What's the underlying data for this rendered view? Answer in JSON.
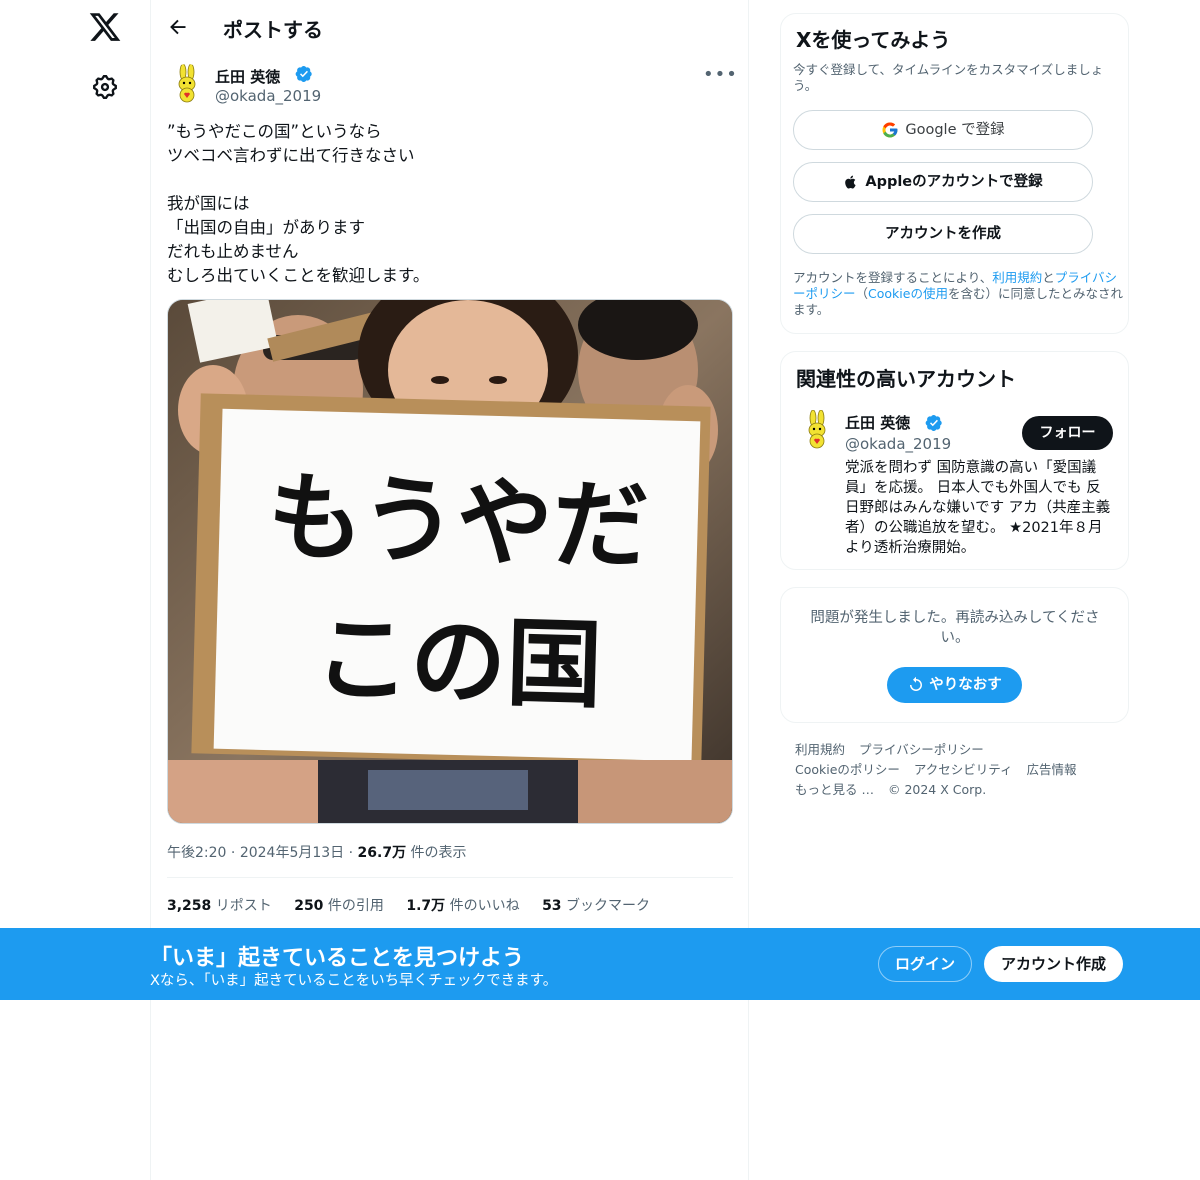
{
  "nav": {
    "logo_icon": "x-logo-icon",
    "settings_icon": "gear-icon"
  },
  "header": {
    "title": "ポストする",
    "back_icon": "arrow-left-icon"
  },
  "post": {
    "author_name": "丘田 英徳",
    "author_handle": "@okada_2019",
    "verified": true,
    "text": "”もうやだこの国”というなら\nツベコベ言わずに出て行きなさい\n\n我が国には\n「出国の自由」があります\nだれも止めません\nむしろ出ていくことを歓迎します。",
    "image_sign_line1": "もうやだ",
    "image_sign_line2": "この国",
    "time": "午後2:20",
    "date": "2024年5月13日",
    "views_count": "26.7万",
    "views_label": "件の表示",
    "stats": {
      "reposts_count": "3,258",
      "reposts_label": "リポスト",
      "quotes_count": "250",
      "quotes_label": "件の引用",
      "likes_count": "1.7万",
      "likes_label": "件のいいね",
      "bookmarks_count": "53",
      "bookmarks_label": "ブックマーク"
    }
  },
  "signup_card": {
    "title": "Xを使ってみよう",
    "subtitle": "今すぐ登録して、タイムラインをカスタマイズしましょう。",
    "google_label": "Google で登録",
    "apple_label": "Appleのアカウントで登録",
    "create_label": "アカウントを作成",
    "terms_prefix": "アカウントを登録することにより、",
    "terms_link": "利用規約",
    "terms_and": "と",
    "privacy_link": "プライバシーポリシー",
    "terms_paren_open": "（",
    "cookie_link": "Cookieの使用",
    "terms_suffix": "を含む）に同意したとみなされます。"
  },
  "related": {
    "title": "関連性の高いアカウント",
    "name": "丘田 英徳",
    "handle": "@okada_2019",
    "follow_label": "フォロー",
    "bio": "党派を問わず 国防意識の高い「愛国議員」を応援。 日本人でも外国人でも 反日野郎はみんな嫌いです アカ（共産主義者）の公職追放を望む。 ★2021年８月より透析治療開始。"
  },
  "error_card": {
    "message": "問題が発生しました。再読み込みしてください。",
    "retry_label": "やりなおす"
  },
  "footer": {
    "links": [
      "利用規約",
      "プライバシーポリシー",
      "Cookieのポリシー",
      "アクセシビリティ",
      "広告情報",
      "もっと見る …"
    ],
    "copyright": "© 2024 X Corp."
  },
  "banner": {
    "title": "「いま」起きていることを見つけよう",
    "subtitle": "Xなら、「いま」起きていることをいち早くチェックできます。",
    "login_label": "ログイン",
    "signup_label": "アカウント作成"
  },
  "colors": {
    "accent": "#1d9bf0",
    "text": "#0f1419",
    "muted": "#536471"
  }
}
